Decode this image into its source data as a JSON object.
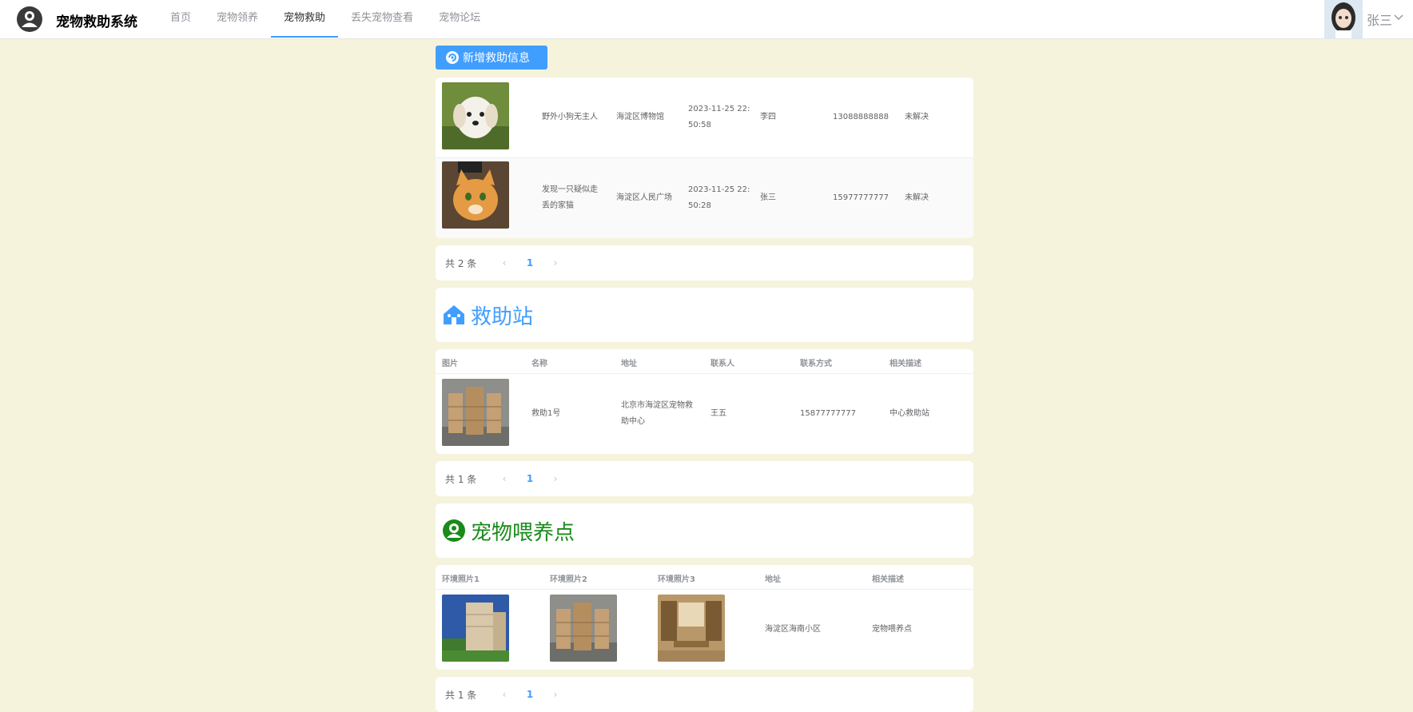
{
  "app": {
    "title": "宠物救助系统"
  },
  "nav": {
    "items": [
      {
        "label": "首页"
      },
      {
        "label": "宠物领养"
      },
      {
        "label": "宠物救助"
      },
      {
        "label": "丢失宠物查看"
      },
      {
        "label": "宠物论坛"
      }
    ],
    "active_index": 2
  },
  "user": {
    "name": "张三"
  },
  "toolbar": {
    "add_label": "新增救助信息"
  },
  "rescue_list": {
    "rows": [
      {
        "image": "puppy-photo",
        "title": "野外小狗无主人",
        "location": "海淀区博物馆",
        "time_line1": "2023-11-25 22:",
        "time_line2": "50:58",
        "contact": "李四",
        "phone": "13088888888",
        "status": "未解决"
      },
      {
        "image": "cat-photo",
        "title_line1": "发现一只疑似走",
        "title_line2": "丢的家猫",
        "location": "海淀区人民广场",
        "time_line1": "2023-11-25 22:",
        "time_line2": "50:28",
        "contact": "张三",
        "phone": "15977777777",
        "status": "未解决"
      }
    ],
    "pager": {
      "total": "共 2 条",
      "page": "1"
    }
  },
  "stations": {
    "title": "救助站",
    "title_color": "#409eff",
    "headers": [
      "图片",
      "名称",
      "地址",
      "联系人",
      "联系方式",
      "相关描述"
    ],
    "rows": [
      {
        "image": "warehouse-photo",
        "name": "救助1号",
        "address_line1": "北京市海淀区宠物救",
        "address_line2": "助中心",
        "contact": "王五",
        "phone": "15877777777",
        "desc": "中心救助站"
      }
    ],
    "pager": {
      "total": "共 1 条",
      "page": "1"
    }
  },
  "feeding": {
    "title": "宠物喂养点",
    "title_color": "#1a8a1a",
    "headers": [
      "环境照片1",
      "环境照片2",
      "环境照片3",
      "地址",
      "相关描述"
    ],
    "rows": [
      {
        "image1": "building-photo",
        "image2": "warehouse-photo",
        "image3": "library-photo",
        "address": "海淀区海南小区",
        "desc": "宠物喂养点"
      }
    ],
    "pager": {
      "total": "共 1 条",
      "page": "1"
    }
  },
  "colors": {
    "accent": "#409eff",
    "background": "#f5f3dc"
  }
}
